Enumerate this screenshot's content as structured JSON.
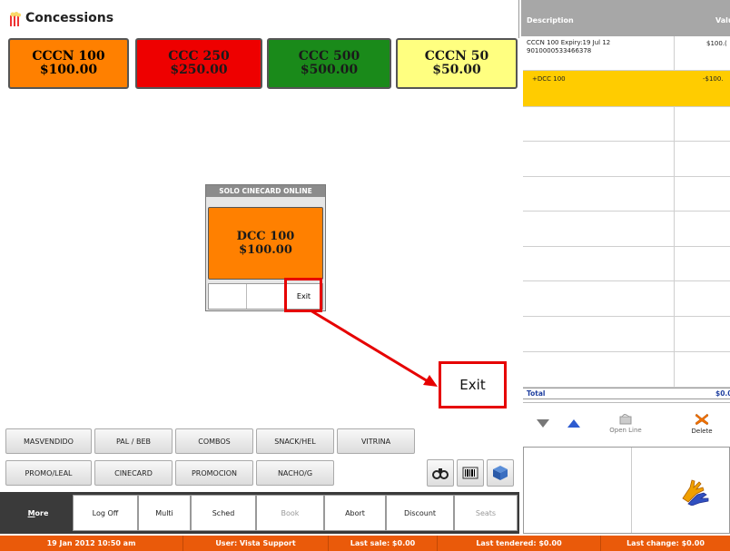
{
  "app": {
    "title": "Concessions",
    "icon": "popcorn-icon"
  },
  "top_buttons": [
    {
      "name": "CCCN 100",
      "price": "$100.00",
      "color": "#ff8000"
    },
    {
      "name": "CCC 250",
      "price": "$250.00",
      "color": "#ee0000"
    },
    {
      "name": "CCC 500",
      "price": "$500.00",
      "color": "#1a8a1a"
    },
    {
      "name": "CCCN 50",
      "price": "$50.00",
      "color": "#ffff80"
    }
  ],
  "dialog": {
    "header": "SOLO CINECARD ONLINE",
    "item": {
      "name": "DCC 100",
      "price": "$100.00"
    },
    "exit_label": "Exit"
  },
  "callout": {
    "exit_label": "Exit"
  },
  "categories_row1": [
    "MASVENDIDO",
    "PAL / BEB",
    "COMBOS",
    "SNACK/HEL",
    "VITRINA"
  ],
  "categories_row2": [
    "PROMO/LEAL",
    "CINECARD",
    "PROMOCION",
    "NACHO/G"
  ],
  "icon_buttons": [
    "binoculars-icon",
    "barcode-icon",
    "box-icon"
  ],
  "bottom_bar": [
    {
      "label": "More",
      "key": "M",
      "rest": "ore"
    },
    {
      "label": "Log Off"
    },
    {
      "label": "Multi"
    },
    {
      "label": "Sched"
    },
    {
      "label": "Book"
    },
    {
      "label": "Abort"
    },
    {
      "label": "Discount"
    },
    {
      "label": "Seats"
    }
  ],
  "order": {
    "columns": {
      "description": "Description",
      "value": "Valu"
    },
    "rows": [
      {
        "line1": "CCCN 100  Expiry:19 Jul 12",
        "line2": "9010000533466378",
        "value": "$100.("
      },
      {
        "line1": "+DCC 100",
        "value": "-$100."
      }
    ],
    "total_label": "Total",
    "total_value": "$0.0",
    "tools": {
      "down": "chevron-down-icon",
      "up": "chevron-up-icon",
      "open_line": "Open Line",
      "delete": "Delete"
    }
  },
  "status": [
    "19 Jan 2012 10:50 am",
    "User: Vista Support",
    "Last sale: $0.00",
    "Last tendered: $0.00",
    "Last change: $0.00"
  ],
  "colors": {
    "highlight_row": "#ffcc00",
    "status_bar": "#ea5a0a",
    "callout": "#e60000"
  }
}
